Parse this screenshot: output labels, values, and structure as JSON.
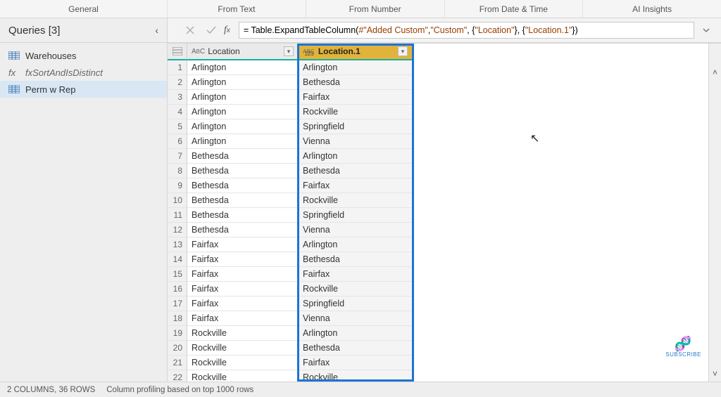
{
  "ribbon": {
    "groups": [
      "General",
      "From Text",
      "From Number",
      "From Date & Time",
      "AI Insights"
    ]
  },
  "sidebar": {
    "title": "Queries [3]",
    "items": [
      {
        "label": "Warehouses",
        "kind": "table",
        "active": false
      },
      {
        "label": "fxSortAndIsDistinct",
        "kind": "fx",
        "active": false
      },
      {
        "label": "Perm w Rep",
        "kind": "table",
        "active": true
      }
    ]
  },
  "formula": {
    "prefix": "= Table.ExpandTableColumn(",
    "arg1": "#\"Added Custom\"",
    "sep1": ", ",
    "arg2": "\"Custom\"",
    "sep2": ", {",
    "arg3": "\"Location\"",
    "sep3": "}, {",
    "arg4": "\"Location.1\"",
    "suffix": "})"
  },
  "grid": {
    "columns": [
      {
        "type_label": "ABC",
        "name": "Location",
        "selected": false
      },
      {
        "type_label": "ABC 123",
        "name": "Location.1",
        "selected": true
      }
    ],
    "rows": [
      [
        "Arlington",
        "Arlington"
      ],
      [
        "Arlington",
        "Bethesda"
      ],
      [
        "Arlington",
        "Fairfax"
      ],
      [
        "Arlington",
        "Rockville"
      ],
      [
        "Arlington",
        "Springfield"
      ],
      [
        "Arlington",
        "Vienna"
      ],
      [
        "Bethesda",
        "Arlington"
      ],
      [
        "Bethesda",
        "Bethesda"
      ],
      [
        "Bethesda",
        "Fairfax"
      ],
      [
        "Bethesda",
        "Rockville"
      ],
      [
        "Bethesda",
        "Springfield"
      ],
      [
        "Bethesda",
        "Vienna"
      ],
      [
        "Fairfax",
        "Arlington"
      ],
      [
        "Fairfax",
        "Bethesda"
      ],
      [
        "Fairfax",
        "Fairfax"
      ],
      [
        "Fairfax",
        "Rockville"
      ],
      [
        "Fairfax",
        "Springfield"
      ],
      [
        "Fairfax",
        "Vienna"
      ],
      [
        "Rockville",
        "Arlington"
      ],
      [
        "Rockville",
        "Bethesda"
      ],
      [
        "Rockville",
        "Fairfax"
      ],
      [
        "Rockville",
        "Rockville"
      ]
    ]
  },
  "status": {
    "left": "2 COLUMNS, 36 ROWS",
    "right": "Column profiling based on top 1000 rows"
  },
  "logo_text": "SUBSCRIBE"
}
